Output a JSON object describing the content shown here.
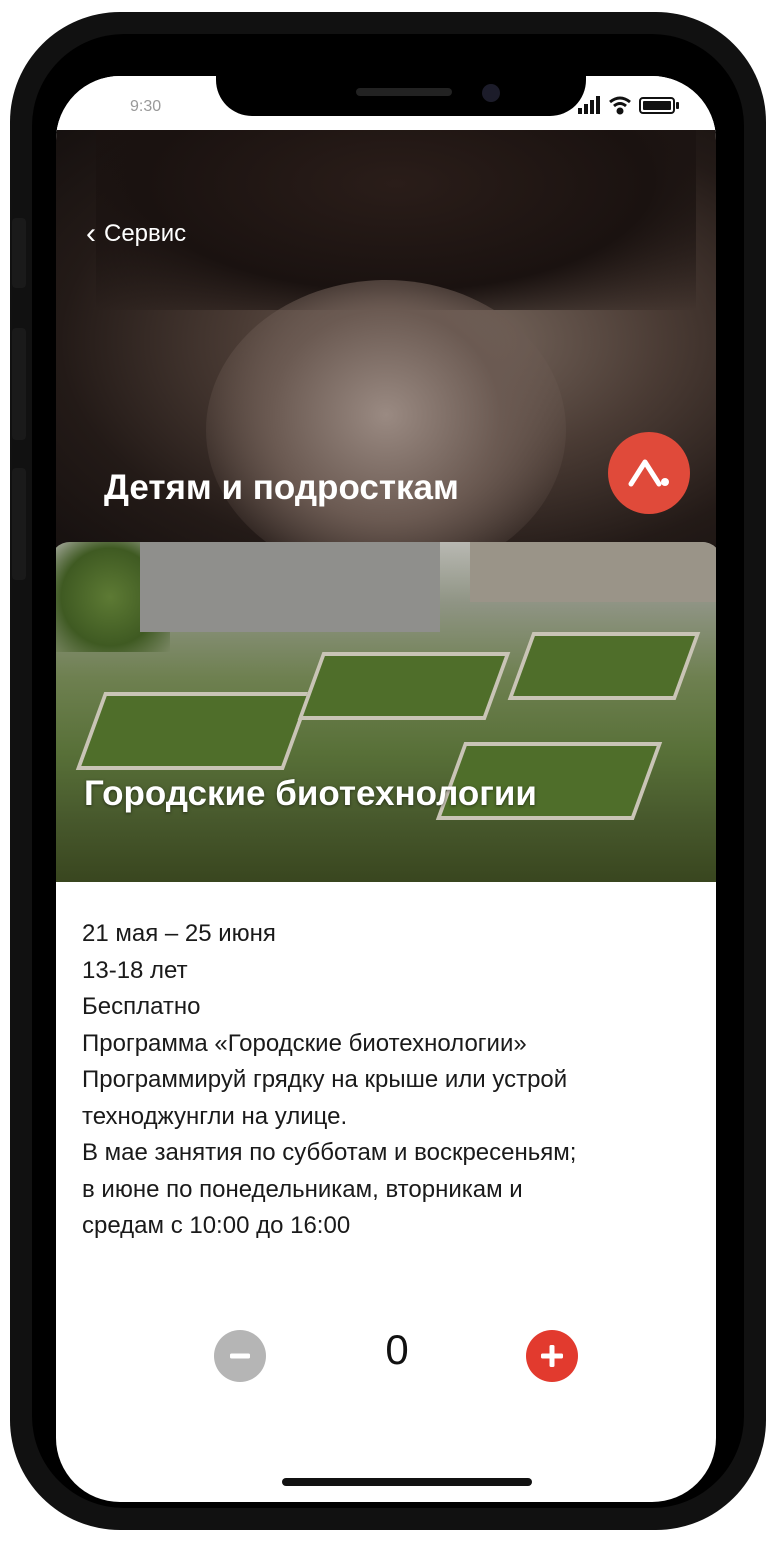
{
  "status_bar": {
    "time": "9:30"
  },
  "header": {
    "back_label": "Сервис",
    "title": "Детям и подросткам"
  },
  "card": {
    "title": "Городские биотехнологии"
  },
  "details": {
    "lines": [
      "21 мая – 25 июня",
      "13-18 лет",
      "Бесплатно",
      "Программа «Городские биотехнологии»",
      "Программируй грядку на крыше или устрой",
      "техноджунгли на улице.",
      "В мае занятия по субботам и воскресеньям;",
      "в июне по понедельникам, вторникам и",
      "средам с 10:00 до 16:00"
    ]
  },
  "counter": {
    "value": "0"
  },
  "colors": {
    "accent": "#e23a2e",
    "disabled": "#b5b5b5"
  },
  "icons": {
    "back": "chevron-left-icon",
    "logo": "brand-logo-icon",
    "minus": "minus-icon",
    "plus": "plus-icon"
  }
}
